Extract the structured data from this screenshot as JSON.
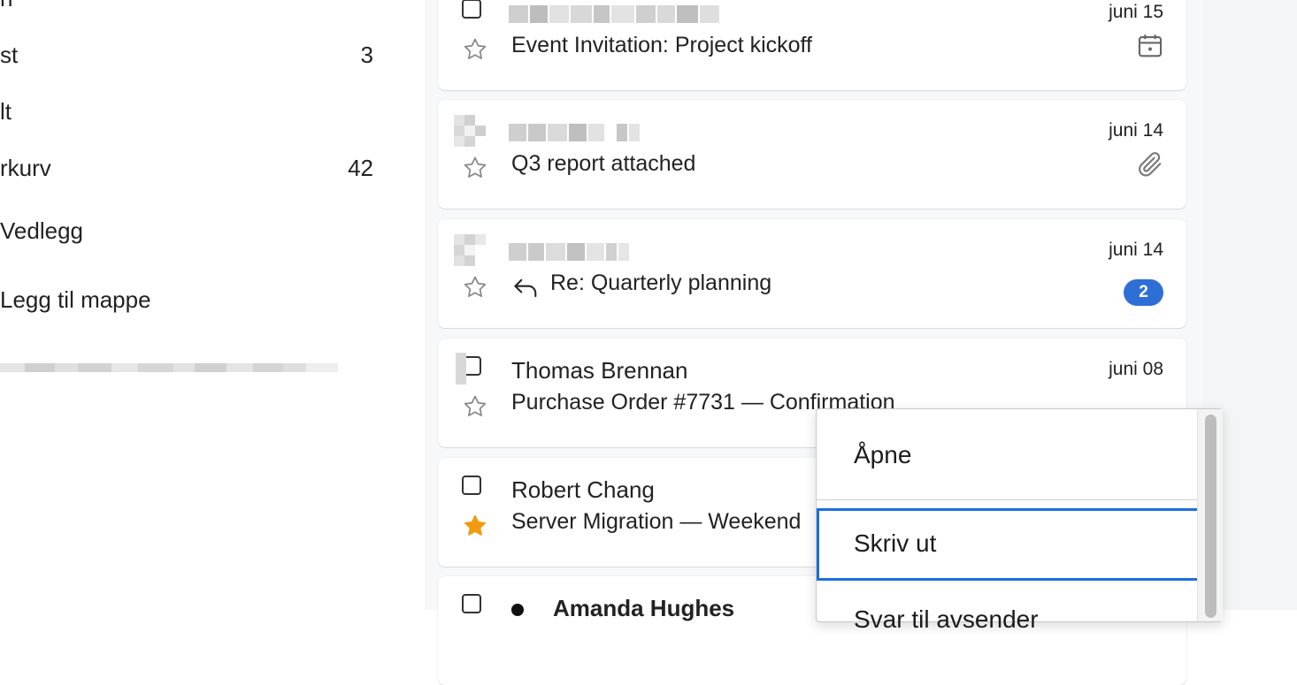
{
  "sidebar": {
    "items": [
      {
        "label": "n",
        "count": ""
      },
      {
        "label": "st",
        "count": "3"
      },
      {
        "label": "lt",
        "count": ""
      },
      {
        "label": "rkurv",
        "count": "42"
      },
      {
        "label": "Vedlegg",
        "count": ""
      },
      {
        "label": "Legg til mappe",
        "count": ""
      }
    ]
  },
  "emails": [
    {
      "sender": "",
      "date": "juni 15",
      "subject": "Event Invitation: Project kickoff",
      "icon": "calendar-icon",
      "starred": false
    },
    {
      "sender": "",
      "date": "juni 14",
      "subject": "Q3 report attached",
      "icon": "paperclip-icon",
      "starred": false
    },
    {
      "sender": "",
      "date": "juni 14",
      "subject": "Re: Quarterly planning",
      "icon": "reply-icon",
      "badge": "2",
      "starred": false
    },
    {
      "sender": "Thomas Brennan",
      "date": "juni 08",
      "subject": "Purchase Order #7731 — Confirmation",
      "starred": false
    },
    {
      "sender": "Robert Chang",
      "date": "",
      "subject": "Server Migration — Weekend",
      "starred": true
    },
    {
      "sender": "Amanda Hughes",
      "date": "",
      "subject": "",
      "starred": false,
      "unread": true
    }
  ],
  "context_menu": {
    "items": [
      "Åpne",
      "Skriv ut",
      "Svar til avsender"
    ],
    "focused": "Skriv ut"
  },
  "colors": {
    "accent": "#2e6fd6",
    "focus_ring": "#1b6fe0",
    "star_filled": "#f29a0e"
  }
}
